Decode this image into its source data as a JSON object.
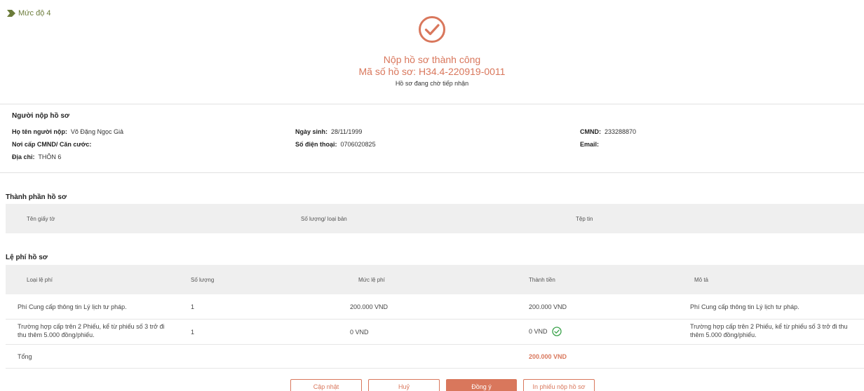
{
  "level": {
    "label": "Mức độ 4"
  },
  "status": {
    "title": "Nộp hồ sơ thành công",
    "code": "Mã số hồ sơ: H34.4-220919-0011",
    "subtitle": "Hồ sơ đang chờ tiếp nhận"
  },
  "applicant": {
    "heading": "Người nộp hồ sơ",
    "fields": {
      "name_label": "Họ tên người nộp:",
      "name_value": "Võ Đặng Ngọc Giả",
      "dob_label": "Ngày sinh:",
      "dob_value": "28/11/1999",
      "id_label": "CMND:",
      "id_value": "233288870",
      "issue_label": "Nơi cấp CMND/ Căn cước:",
      "issue_value": "",
      "phone_label": "Số điện thoại:",
      "phone_value": "0706020825",
      "email_label": "Email:",
      "email_value": "",
      "address_label": "Địa chỉ:",
      "address_value": "THÔN 6"
    }
  },
  "documents": {
    "heading": "Thành phần hồ sơ",
    "columns": [
      "Tên giấy tờ",
      "Số lượng/ loại bản",
      "Tệp tin"
    ]
  },
  "fees": {
    "heading": "Lệ phí hồ sơ",
    "columns": [
      "Loại lệ phí",
      "Số lượng",
      "Mức lệ phí",
      "Thành tiền",
      "Mô tả"
    ],
    "rows": [
      {
        "type": "Phí Cung cấp thông tin Lý lịch tư pháp.",
        "qty": "1",
        "rate": "200.000 VND",
        "amount": "200.000 VND",
        "desc": "Phí Cung cấp thông tin Lý lịch tư pháp."
      },
      {
        "type": "Trường hợp cấp trên 2 Phiếu, kể từ phiếu số 3 trở đi thu thêm 5.000 đồng/phiếu.",
        "qty": "1",
        "rate": "0 VND",
        "amount": "0 VND",
        "desc": "Trường hợp cấp trên 2 Phiếu, kể từ phiếu số 3 trở đi thu thêm 5.000 đồng/phiếu."
      }
    ],
    "total_label": "Tổng",
    "total_value": "200.000 VND"
  },
  "actions": {
    "update": "Cập nhật",
    "cancel": "Huỷ",
    "agree": "Đồng ý",
    "print": "In phiếu nộp hồ sơ"
  },
  "colors": {
    "accent": "#d9775c",
    "level": "#6b7b3a",
    "header_bg": "#efefef"
  }
}
